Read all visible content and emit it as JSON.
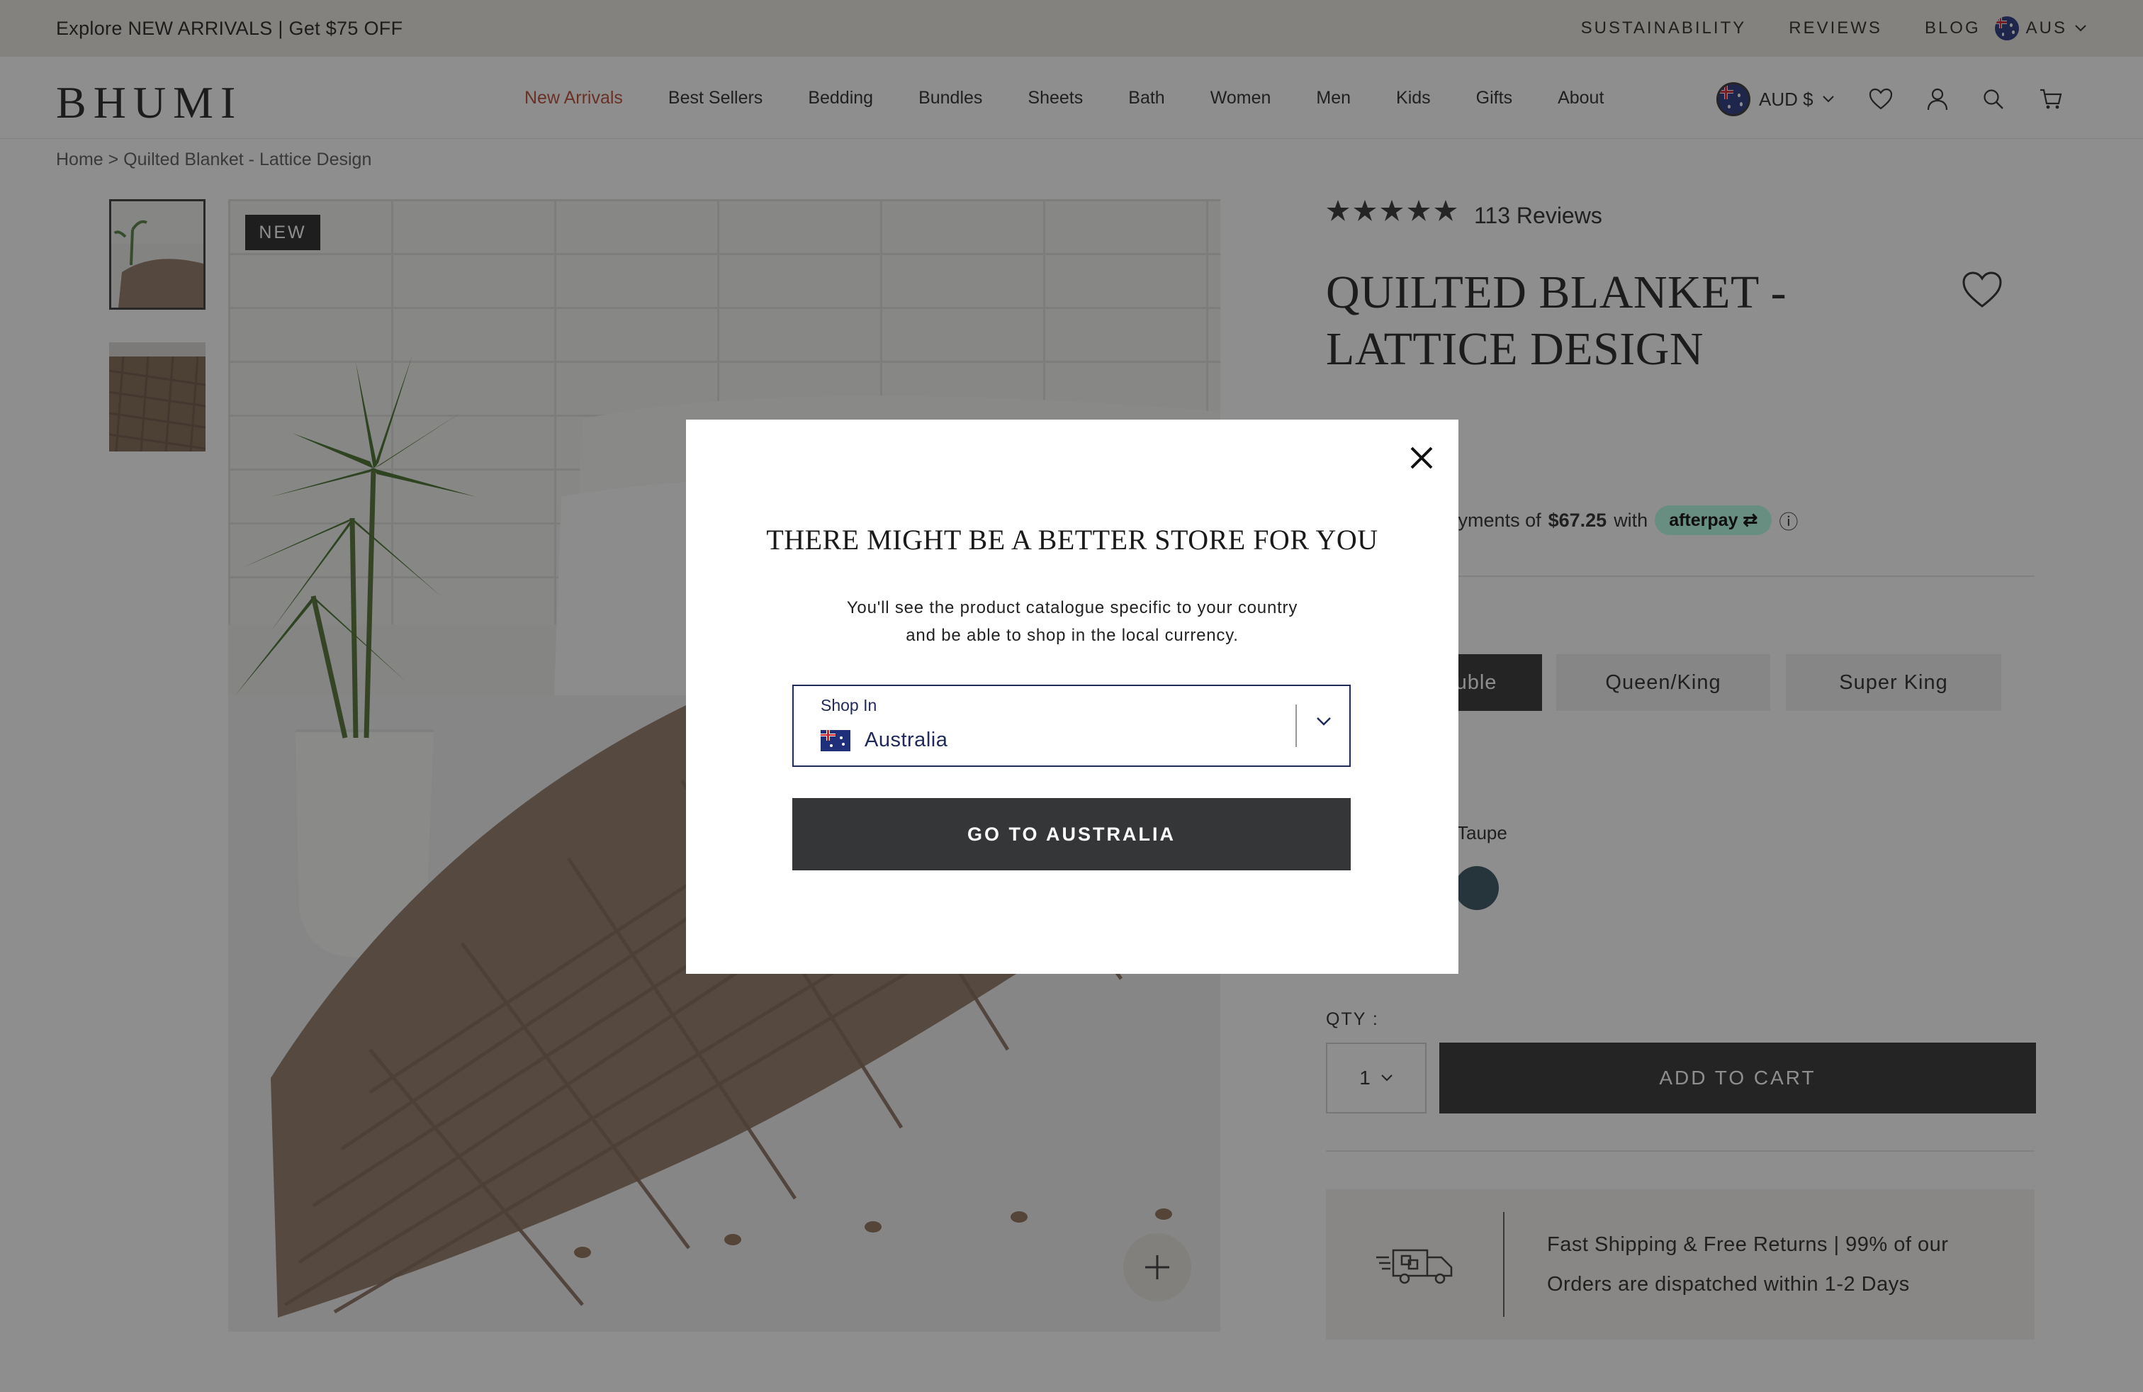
{
  "announcement": {
    "promo": "Explore NEW ARRIVALS | Get $75 OFF",
    "links": [
      "SUSTAINABILITY",
      "REVIEWS",
      "BLOG"
    ],
    "region": "AUS"
  },
  "header": {
    "logo": "BHUMI",
    "nav": [
      "New Arrivals",
      "Best Sellers",
      "Bedding",
      "Bundles",
      "Sheets",
      "Bath",
      "Women",
      "Men",
      "Kids",
      "Gifts",
      "About"
    ],
    "currency": "AUD $"
  },
  "breadcrumb": "Home > Quilted Blanket - Lattice Design",
  "gallery": {
    "badge": "NEW"
  },
  "product": {
    "rating": 5,
    "reviews": "113 Reviews",
    "title": "QUILTED BLANKET - LATTICE DESIGN",
    "afterpay_prefix": "e payments of",
    "afterpay_amount": "$67.25",
    "afterpay_with": "with",
    "afterpay_brand": "afterpay",
    "afterpay_info": "ⓘ",
    "sizes": [
      "uble",
      "Queen/King",
      "Super King"
    ],
    "color_name": "Taupe",
    "qty_label": "QTY :",
    "qty_value": "1",
    "add_to_cart": "ADD TO CART",
    "shipping_line1": "Fast Shipping & Free Returns | 99% of our",
    "shipping_line2": "Orders are dispatched within 1-2 Days"
  },
  "modal": {
    "title": "THERE MIGHT BE A BETTER STORE FOR YOU",
    "text_line1": "You'll see the product catalogue specific to your country",
    "text_line2": "and be able to shop in the local currency.",
    "select_label": "Shop In",
    "select_value": "Australia",
    "button": "GO TO AUSTRALIA"
  },
  "colors": {
    "accent_nav": "#b5452e",
    "dark_button": "#2b2b2b",
    "afterpay": "#b2fce4",
    "swatch": "#2e4a5b"
  }
}
